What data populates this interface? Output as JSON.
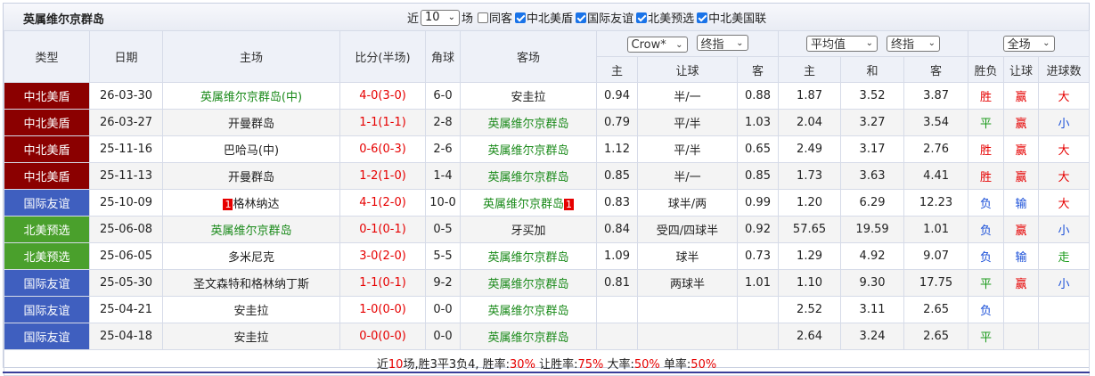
{
  "title": "英属维尔京群岛",
  "filters": {
    "near_label": "近",
    "count": "10",
    "count_suffix": "场",
    "same_venue": "同客",
    "leagues": [
      "中北美盾",
      "国际友谊",
      "北美预选",
      "中北美国联"
    ]
  },
  "headers": {
    "type": "类型",
    "date": "日期",
    "home": "主场",
    "score": "比分(半场)",
    "corner": "角球",
    "away": "客场",
    "company": "Crow*",
    "handicap_mode": "终指",
    "avg_mode": "平均值",
    "eu_mode": "终指",
    "scope": "全场",
    "sub": {
      "h_home": "主",
      "h_line": "让球",
      "h_away": "客",
      "e_home": "主",
      "e_draw": "和",
      "e_away": "客",
      "res": "胜负",
      "hres": "让球",
      "goals": "进球数"
    }
  },
  "colors": {
    "中北美盾": "#8b0000",
    "国际友谊": "#3f5fbf",
    "北美预选": "#4aa02c"
  },
  "rows": [
    {
      "league": "中北美盾",
      "date": "26-03-30",
      "home": "英属维尔京群岛(中)",
      "home_fav": true,
      "score": "4-0",
      "half": "(3-0)",
      "corner": "6-0",
      "away": "安圭拉",
      "away_fav": false,
      "h1": "0.94",
      "hl": "半/一",
      "h2": "0.88",
      "e1": "1.87",
      "ed": "3.52",
      "e2": "3.87",
      "res": "胜",
      "res_c": "red",
      "hres": "赢",
      "hres_c": "red",
      "goals": "大",
      "goals_c": "red"
    },
    {
      "league": "中北美盾",
      "date": "26-03-27",
      "home": "开曼群岛",
      "home_fav": false,
      "score": "1-1",
      "half": "(1-1)",
      "corner": "2-8",
      "away": "英属维尔京群岛",
      "away_fav": true,
      "h1": "0.79",
      "hl": "平/半",
      "h2": "1.03",
      "e1": "2.04",
      "ed": "3.27",
      "e2": "3.54",
      "res": "平",
      "res_c": "green",
      "hres": "赢",
      "hres_c": "red",
      "goals": "小",
      "goals_c": "blue"
    },
    {
      "league": "中北美盾",
      "date": "25-11-16",
      "home": "巴哈马(中)",
      "home_fav": false,
      "score": "0-6",
      "half": "(0-3)",
      "corner": "2-6",
      "away": "英属维尔京群岛",
      "away_fav": true,
      "h1": "1.12",
      "hl": "平/半",
      "h2": "0.65",
      "e1": "2.49",
      "ed": "3.17",
      "e2": "2.76",
      "res": "胜",
      "res_c": "red",
      "hres": "赢",
      "hres_c": "red",
      "goals": "大",
      "goals_c": "red"
    },
    {
      "league": "中北美盾",
      "date": "25-11-13",
      "home": "开曼群岛",
      "home_fav": false,
      "score": "1-2",
      "half": "(1-0)",
      "corner": "1-4",
      "away": "英属维尔京群岛",
      "away_fav": true,
      "h1": "0.85",
      "hl": "半/一",
      "h2": "0.85",
      "e1": "1.73",
      "ed": "3.63",
      "e2": "4.41",
      "res": "胜",
      "res_c": "red",
      "hres": "赢",
      "hres_c": "red",
      "goals": "大",
      "goals_c": "red"
    },
    {
      "league": "国际友谊",
      "date": "25-10-09",
      "home": "格林纳达",
      "home_rank": "1",
      "home_fav": false,
      "score": "4-1",
      "half": "(2-0)",
      "corner": "10-0",
      "away": "英属维尔京群岛",
      "away_rank": "1",
      "away_fav": true,
      "h1": "0.83",
      "hl": "球半/两",
      "h2": "0.99",
      "e1": "1.20",
      "ed": "6.29",
      "e2": "12.23",
      "res": "负",
      "res_c": "blue",
      "hres": "输",
      "hres_c": "blue",
      "goals": "大",
      "goals_c": "red"
    },
    {
      "league": "北美预选",
      "date": "25-06-08",
      "home": "英属维尔京群岛",
      "home_fav": true,
      "score": "0-1",
      "half": "(0-1)",
      "corner": "0-5",
      "away": "牙买加",
      "away_fav": false,
      "h1": "0.84",
      "hl": "受四/四球半",
      "h2": "0.92",
      "e1": "57.65",
      "ed": "19.59",
      "e2": "1.01",
      "res": "负",
      "res_c": "blue",
      "hres": "赢",
      "hres_c": "red",
      "goals": "小",
      "goals_c": "blue"
    },
    {
      "league": "北美预选",
      "date": "25-06-05",
      "home": "多米尼克",
      "home_fav": false,
      "score": "3-0",
      "half": "(2-0)",
      "corner": "5-5",
      "away": "英属维尔京群岛",
      "away_fav": true,
      "h1": "1.09",
      "hl": "球半",
      "h2": "0.73",
      "e1": "1.29",
      "ed": "4.92",
      "e2": "9.07",
      "res": "负",
      "res_c": "blue",
      "hres": "输",
      "hres_c": "blue",
      "goals": "走",
      "goals_c": "green"
    },
    {
      "league": "国际友谊",
      "date": "25-05-30",
      "home": "圣文森特和格林纳丁斯",
      "home_fav": false,
      "score": "1-1",
      "half": "(0-1)",
      "corner": "9-2",
      "away": "英属维尔京群岛",
      "away_fav": true,
      "h1": "0.81",
      "hl": "两球半",
      "h2": "1.01",
      "e1": "1.10",
      "ed": "9.30",
      "e2": "17.75",
      "res": "平",
      "res_c": "green",
      "hres": "赢",
      "hres_c": "red",
      "goals": "小",
      "goals_c": "blue"
    },
    {
      "league": "国际友谊",
      "date": "25-04-21",
      "home": "安圭拉",
      "home_fav": false,
      "score": "1-0",
      "half": "(0-0)",
      "corner": "0-0",
      "away": "英属维尔京群岛",
      "away_fav": true,
      "h1": "",
      "hl": "",
      "h2": "",
      "e1": "2.52",
      "ed": "3.11",
      "e2": "2.65",
      "res": "负",
      "res_c": "blue",
      "hres": "",
      "hres_c": "",
      "goals": "",
      "goals_c": ""
    },
    {
      "league": "国际友谊",
      "date": "25-04-18",
      "home": "安圭拉",
      "home_fav": false,
      "score": "0-0",
      "half": "(0-0)",
      "corner": "0-0",
      "away": "英属维尔京群岛",
      "away_fav": true,
      "h1": "",
      "hl": "",
      "h2": "",
      "e1": "2.64",
      "ed": "3.24",
      "e2": "2.65",
      "res": "平",
      "res_c": "green",
      "hres": "",
      "hres_c": "",
      "goals": "",
      "goals_c": ""
    }
  ],
  "summary": {
    "prefix": "近",
    "count": "10",
    "mid": "场,胜3平3负4, 胜率:",
    "win_rate": "30%",
    "h_label": " 让胜率:",
    "h_rate": "75%",
    "big_label": " 大率:",
    "big_rate": "50%",
    "odd_label": " 单率:",
    "odd_rate": "50%"
  }
}
